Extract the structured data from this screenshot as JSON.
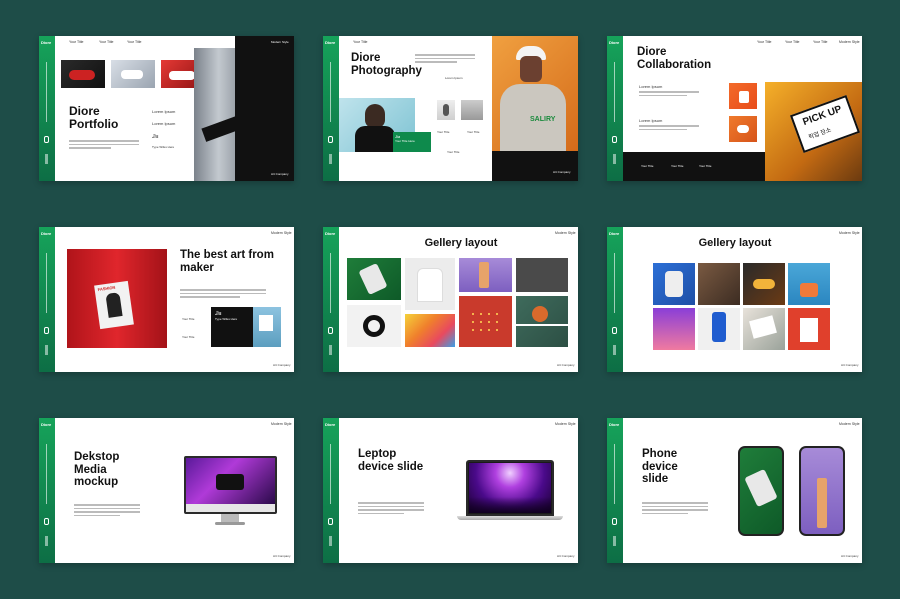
{
  "brand": {
    "logo": "Diore",
    "footer": "Art Company",
    "header_right": "Modern Style"
  },
  "nav": {
    "n1": "Your Title",
    "n2": "Your Title",
    "n3": "Your Title"
  },
  "slides": {
    "s1": {
      "title": "Diore Portfolio",
      "l1": "Lorem Ipsum",
      "l2": "Lorem Ipsum",
      "sig": "Jia",
      "caption": "Type Wifes Here",
      "footer": "Art Company"
    },
    "s2": {
      "title": "Diore Photography",
      "sub": "Lorem Ipsum",
      "sig": "Jia",
      "box": "Your Title Here",
      "labels": [
        "Your Title",
        "Your Title",
        "Your Title"
      ],
      "footer": "Art Company",
      "shirt": "SALIRY"
    },
    "s3": {
      "title": "Diore Collaboration",
      "l1": "Lorem Ipsum",
      "l2": "Lorem Ipsum",
      "band": [
        "Your Title",
        "Your Title",
        "Your Title"
      ],
      "sign": "PICK UP",
      "sign_kr": "픽업 장소"
    },
    "s4": {
      "title": "The best art from maker",
      "labels": [
        "Your Title",
        "Your Title"
      ],
      "sig": "Jia",
      "box": "Type Wifes Here",
      "footer": "Art Company",
      "poster": "FASHION"
    },
    "s5": {
      "title": "Gellery layout",
      "footer": "Art Company"
    },
    "s6": {
      "title": "Gellery layout",
      "footer": "Art Company"
    },
    "s7": {
      "title": "Dekstop Media mockup",
      "footer": "Art Company"
    },
    "s8": {
      "title": "Leptop device slide",
      "footer": "Art Company"
    },
    "s9": {
      "title": "Phone device slide",
      "footer": "Art Company"
    }
  },
  "colors": {
    "background": "#1e4d48",
    "accent": "#16a35a",
    "dark": "#111111"
  }
}
